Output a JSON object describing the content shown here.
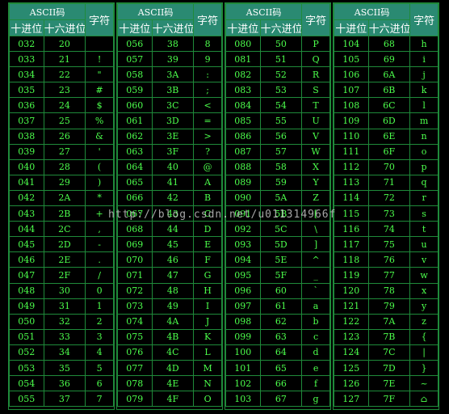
{
  "headers": {
    "ascii_code": "ASCII码",
    "char": "字符",
    "dec": "十进位",
    "hex": "十六进位"
  },
  "groups": [
    {
      "rows": [
        [
          "032",
          "20",
          ""
        ],
        [
          "033",
          "21",
          "!"
        ],
        [
          "034",
          "22",
          "\""
        ],
        [
          "035",
          "23",
          "#"
        ],
        [
          "036",
          "24",
          "$"
        ],
        [
          "037",
          "25",
          "%"
        ],
        [
          "038",
          "26",
          "&"
        ],
        [
          "039",
          "27",
          "'"
        ],
        [
          "040",
          "28",
          "("
        ],
        [
          "041",
          "29",
          ")"
        ],
        [
          "042",
          "2A",
          "*"
        ],
        [
          "043",
          "2B",
          "+"
        ],
        [
          "044",
          "2C",
          ","
        ],
        [
          "045",
          "2D",
          "-"
        ],
        [
          "046",
          "2E",
          "."
        ],
        [
          "047",
          "2F",
          "/"
        ],
        [
          "048",
          "30",
          "0"
        ],
        [
          "049",
          "31",
          "1"
        ],
        [
          "050",
          "32",
          "2"
        ],
        [
          "051",
          "33",
          "3"
        ],
        [
          "052",
          "34",
          "4"
        ],
        [
          "053",
          "35",
          "5"
        ],
        [
          "054",
          "36",
          "6"
        ],
        [
          "055",
          "37",
          "7"
        ]
      ]
    },
    {
      "rows": [
        [
          "056",
          "38",
          "8"
        ],
        [
          "057",
          "39",
          "9"
        ],
        [
          "058",
          "3A",
          ":"
        ],
        [
          "059",
          "3B",
          ";"
        ],
        [
          "060",
          "3C",
          "<"
        ],
        [
          "061",
          "3D",
          "="
        ],
        [
          "062",
          "3E",
          ">"
        ],
        [
          "063",
          "3F",
          "?"
        ],
        [
          "064",
          "40",
          "@"
        ],
        [
          "065",
          "41",
          "A"
        ],
        [
          "066",
          "42",
          "B"
        ],
        [
          "067",
          "43",
          "C"
        ],
        [
          "068",
          "44",
          "D"
        ],
        [
          "069",
          "45",
          "E"
        ],
        [
          "070",
          "46",
          "F"
        ],
        [
          "071",
          "47",
          "G"
        ],
        [
          "072",
          "48",
          "H"
        ],
        [
          "073",
          "49",
          "I"
        ],
        [
          "074",
          "4A",
          "J"
        ],
        [
          "075",
          "4B",
          "K"
        ],
        [
          "076",
          "4C",
          "L"
        ],
        [
          "077",
          "4D",
          "M"
        ],
        [
          "078",
          "4E",
          "N"
        ],
        [
          "079",
          "4F",
          "O"
        ]
      ]
    },
    {
      "rows": [
        [
          "080",
          "50",
          "P"
        ],
        [
          "081",
          "51",
          "Q"
        ],
        [
          "082",
          "52",
          "R"
        ],
        [
          "083",
          "53",
          "S"
        ],
        [
          "084",
          "54",
          "T"
        ],
        [
          "085",
          "55",
          "U"
        ],
        [
          "086",
          "56",
          "V"
        ],
        [
          "087",
          "57",
          "W"
        ],
        [
          "088",
          "58",
          "X"
        ],
        [
          "089",
          "59",
          "Y"
        ],
        [
          "090",
          "5A",
          "Z"
        ],
        [
          "091",
          "5B",
          "["
        ],
        [
          "092",
          "5C",
          "\\"
        ],
        [
          "093",
          "5D",
          "]"
        ],
        [
          "094",
          "5E",
          "^"
        ],
        [
          "095",
          "5F",
          "_"
        ],
        [
          "096",
          "60",
          "`"
        ],
        [
          "097",
          "61",
          "a"
        ],
        [
          "098",
          "62",
          "b"
        ],
        [
          "099",
          "63",
          "c"
        ],
        [
          "100",
          "64",
          "d"
        ],
        [
          "101",
          "65",
          "e"
        ],
        [
          "102",
          "66",
          "f"
        ],
        [
          "103",
          "67",
          "g"
        ]
      ]
    },
    {
      "rows": [
        [
          "104",
          "68",
          "h"
        ],
        [
          "105",
          "69",
          "i"
        ],
        [
          "106",
          "6A",
          "j"
        ],
        [
          "107",
          "6B",
          "k"
        ],
        [
          "108",
          "6C",
          "l"
        ],
        [
          "109",
          "6D",
          "m"
        ],
        [
          "110",
          "6E",
          "n"
        ],
        [
          "111",
          "6F",
          "o"
        ],
        [
          "112",
          "70",
          "p"
        ],
        [
          "113",
          "71",
          "q"
        ],
        [
          "114",
          "72",
          "r"
        ],
        [
          "115",
          "73",
          "s"
        ],
        [
          "116",
          "74",
          "t"
        ],
        [
          "117",
          "75",
          "u"
        ],
        [
          "118",
          "76",
          "v"
        ],
        [
          "119",
          "77",
          "w"
        ],
        [
          "120",
          "78",
          "x"
        ],
        [
          "121",
          "79",
          "y"
        ],
        [
          "122",
          "7A",
          "z"
        ],
        [
          "123",
          "7B",
          "{"
        ],
        [
          "124",
          "7C",
          "|"
        ],
        [
          "125",
          "7D",
          "}"
        ],
        [
          "126",
          "7E",
          "~"
        ],
        [
          "127",
          "7F",
          "⌂"
        ]
      ]
    }
  ],
  "watermark": "http://blog.csdn.net/u011314966f"
}
